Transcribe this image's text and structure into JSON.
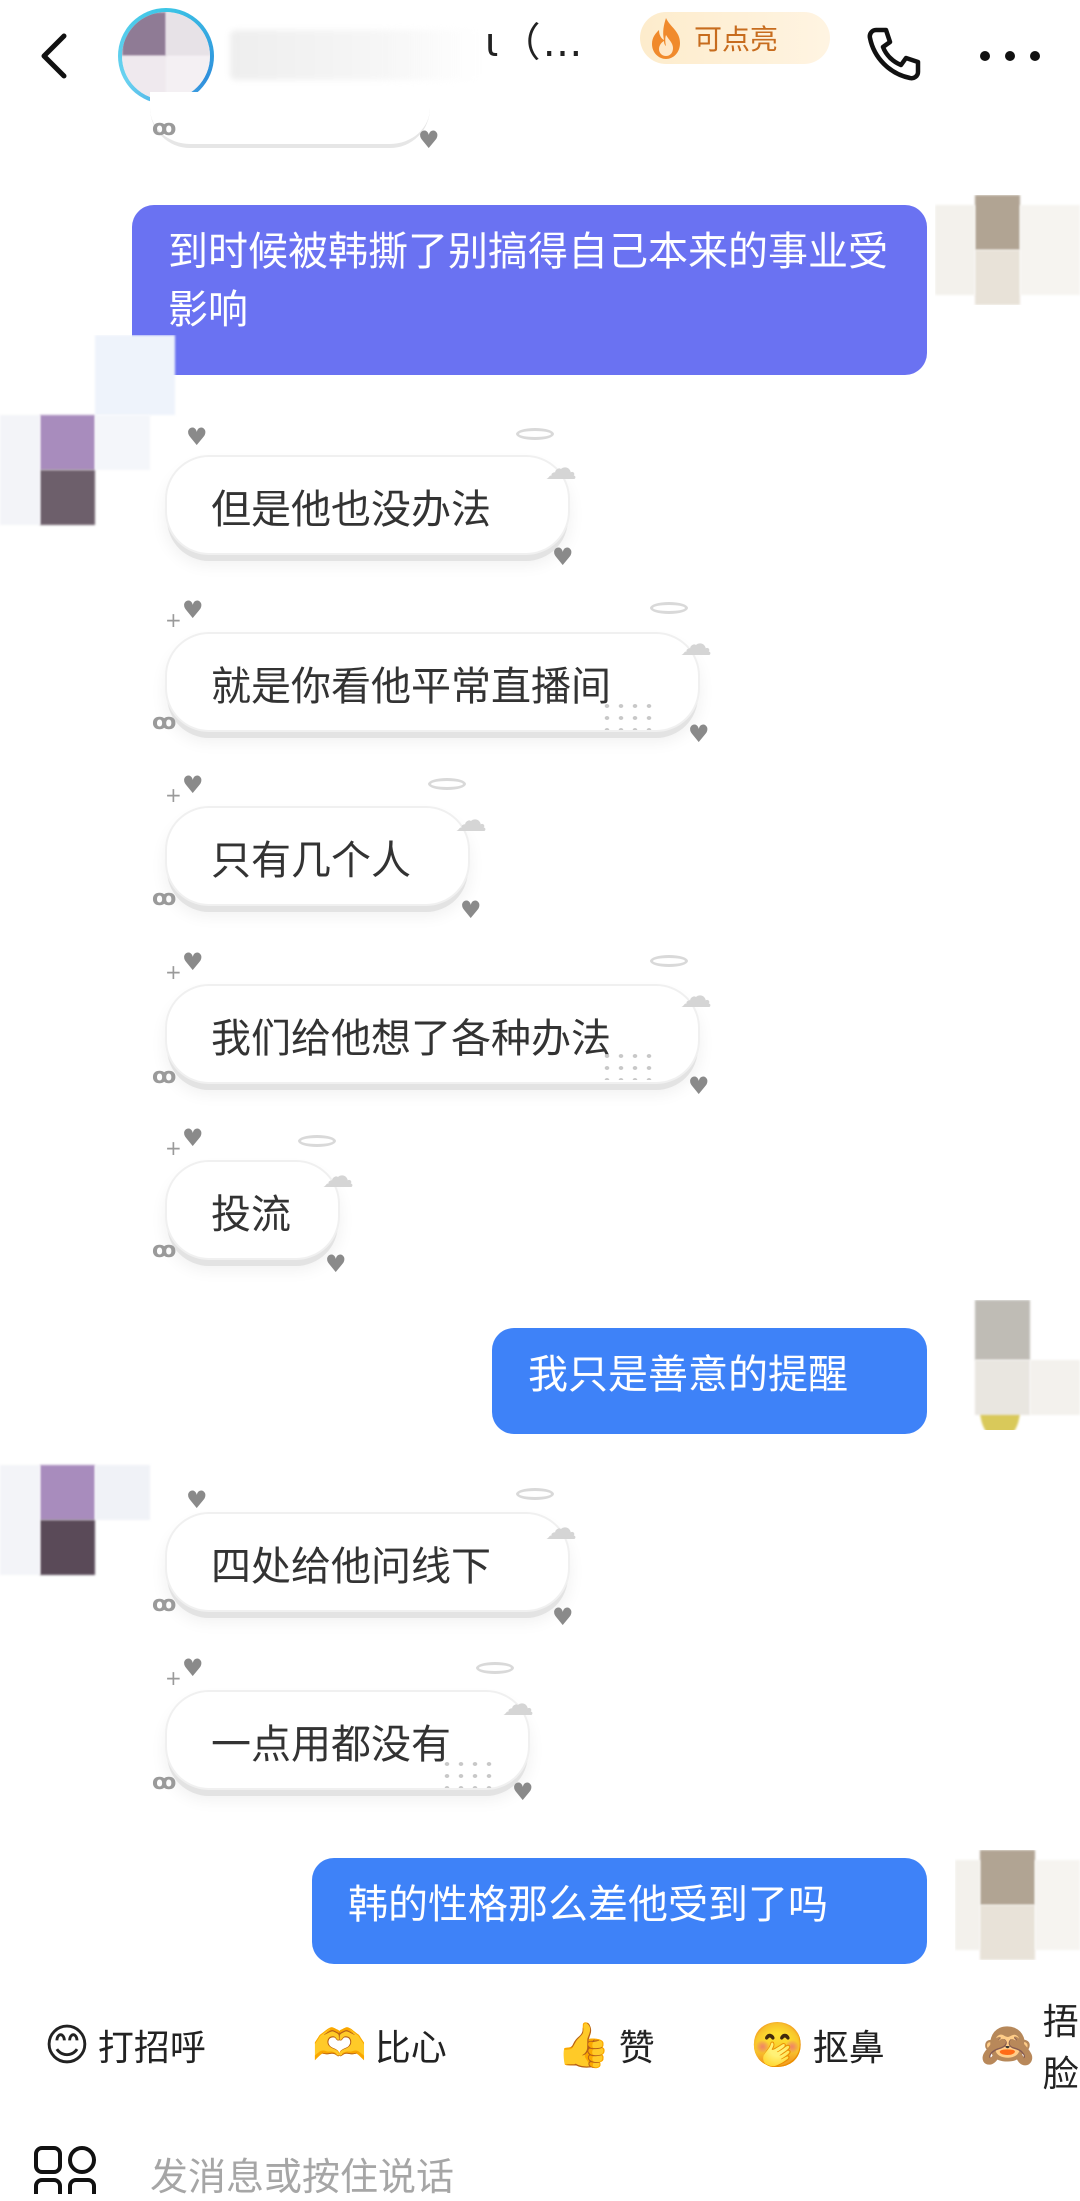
{
  "header": {
    "name": "ɩ（…",
    "badge_label": "可点亮"
  },
  "colors": {
    "outgoing_purple": "#6a72f2",
    "outgoing_blue": "#3e82f8",
    "badge_text": "#c76c1e"
  },
  "messages": [
    {
      "side": "out",
      "text": "到时候被韩撕了别搞得自己本来的事业受影响"
    },
    {
      "side": "in",
      "text": "但是他也没办法"
    },
    {
      "side": "in",
      "text": "就是你看他平常直播间"
    },
    {
      "side": "in",
      "text": "只有几个人"
    },
    {
      "side": "in",
      "text": "我们给他想了各种办法"
    },
    {
      "side": "in",
      "text": "投流"
    },
    {
      "side": "out",
      "text": "我只是善意的提醒"
    },
    {
      "side": "in",
      "text": "四处给他问线下"
    },
    {
      "side": "in",
      "text": "一点用都没有"
    },
    {
      "side": "out",
      "text": "韩的性格那么差他受到了吗"
    }
  ],
  "quick_replies": [
    {
      "emoji": "😊",
      "label": "打招呼"
    },
    {
      "emoji": "🫶",
      "label": "比心"
    },
    {
      "emoji": "👍",
      "label": "赞"
    },
    {
      "emoji": "🤭",
      "label": "抠鼻"
    },
    {
      "emoji": "🙈",
      "label": "捂脸"
    }
  ],
  "input": {
    "placeholder": "发消息或按住说话"
  },
  "icons": [
    "back-icon",
    "fire-icon",
    "phone-icon",
    "more-icon",
    "apps-icon"
  ]
}
